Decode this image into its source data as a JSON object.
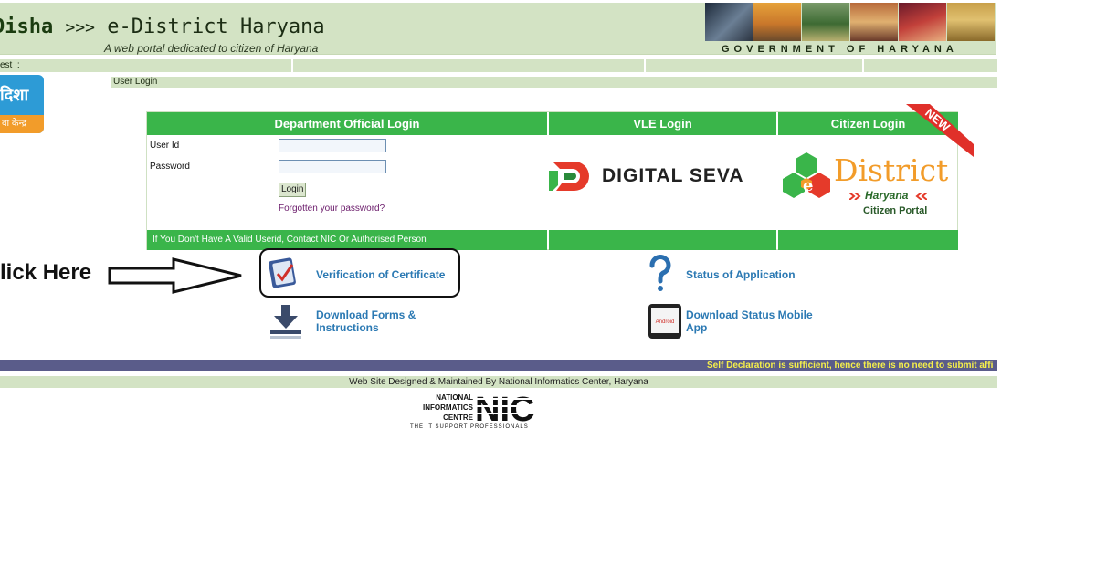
{
  "header": {
    "brand_disha": "Disha",
    "brand_arrows": ">>>",
    "brand_title": "e-District Haryana",
    "tagline": "A web portal dedicated to citizen of Haryana",
    "government_label": "GOVERNMENT OF HARYANA"
  },
  "welcome_bar": {
    "text": "est ::"
  },
  "logo": {
    "text": "दिशा",
    "band_text": "वा केन्द्र"
  },
  "user_login_bar": {
    "label": "User Login"
  },
  "login_panel": {
    "department_heading": "Department Official Login",
    "vle_heading": "VLE Login",
    "citizen_heading": "Citizen Login",
    "userid_label": "User Id",
    "password_label": "Password",
    "userid_value": "",
    "password_value": "",
    "login_button": "Login",
    "forgot_link": "Forgotten your password?",
    "footer_note": "If You Don't Have A Valid Userid, Contact NIC Or Authorised Person",
    "digital_seva_label": "DIGITAL SEVA",
    "edistrict_main": "District",
    "edistrict_sub": "Haryana",
    "edistrict_portal": "Citizen Portal",
    "new_badge": "NEW"
  },
  "annotation": {
    "click_here": "lick Here"
  },
  "links": {
    "verification": "Verification of Certificate",
    "status": "Status of Application",
    "download_forms_line1": "Download Forms &",
    "download_forms_line2": "Instructions",
    "download_app_line1": "Download Status Mobile",
    "download_app_line2": "App",
    "android_label": "Android"
  },
  "marquee": {
    "text": "Self Declaration is sufficient, hence there is no need to submit affi"
  },
  "footer": {
    "text": "Web Site Designed & Maintained By National Informatics Center, Haryana",
    "nic_line1": "NATIONAL",
    "nic_line2": "INFORMATICS",
    "nic_line3": "CENTRE",
    "nic_logo": "NIC",
    "nic_tagline": "THE IT SUPPORT PROFESSIONALS"
  },
  "colors": {
    "header_bg": "#d3e3c4",
    "login_green": "#3ab54a",
    "link_blue": "#2b79b3",
    "marquee_bg": "#5a5c8a",
    "marquee_text": "#f6f04a",
    "edistrict_orange": "#f29c2a"
  }
}
